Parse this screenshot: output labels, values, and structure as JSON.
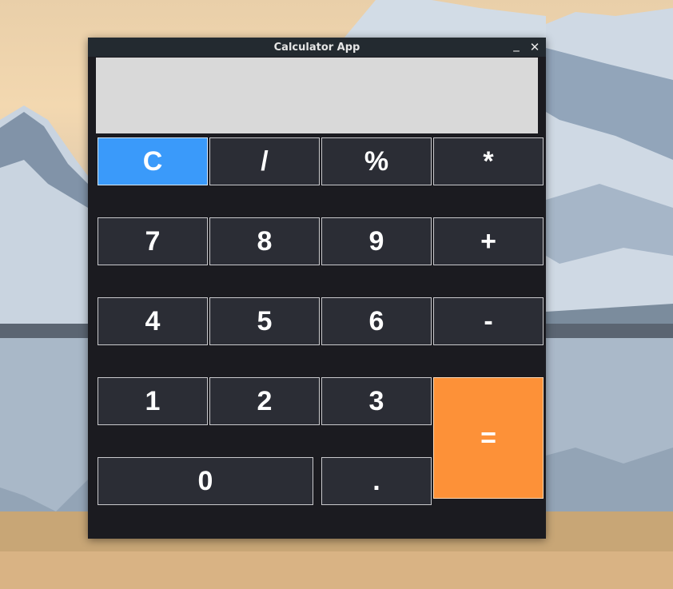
{
  "window": {
    "title": "Calculator App",
    "minimize_glyph": "_",
    "close_glyph": "✕"
  },
  "display": {
    "value": ""
  },
  "keys": {
    "clear": "C",
    "divide": "/",
    "percent": "%",
    "multiply": "*",
    "seven": "7",
    "eight": "8",
    "nine": "9",
    "plus": "+",
    "four": "4",
    "five": "5",
    "six": "6",
    "minus": "-",
    "one": "1",
    "two": "2",
    "three": "3",
    "equals": "=",
    "zero": "0",
    "decimal": "."
  },
  "colors": {
    "clear_button": "#3a9afa",
    "equals_button": "#fd9138",
    "key_background": "#2b2d35",
    "window_background": "#1b1b20",
    "display_background": "#d9d9d9"
  }
}
